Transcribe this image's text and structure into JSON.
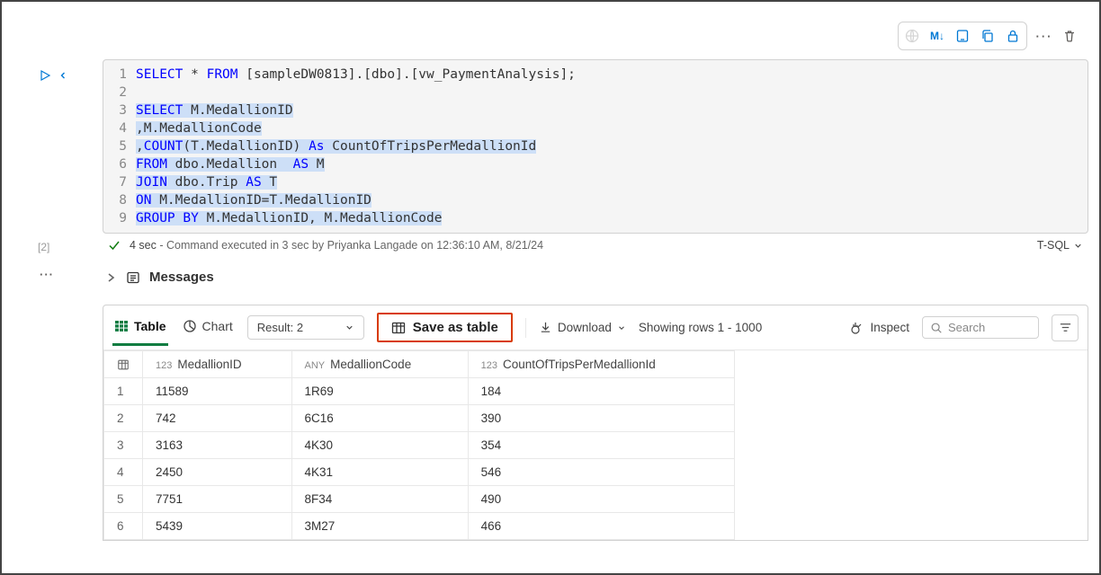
{
  "toolbar": {
    "icons": [
      "globe",
      "markdown",
      "tablet",
      "copy",
      "lock",
      "more",
      "trash"
    ],
    "md_label": "M↓"
  },
  "cell": {
    "exec_count": "[2]",
    "side_more": "···",
    "run_icon": "run",
    "lang": "T-SQL",
    "status_check": "✓",
    "status_bold": "4 sec",
    "status_text": "- Command executed in 3 sec by Priyanka Langade on 12:36:10 AM, 8/21/24"
  },
  "code": {
    "lines": [
      {
        "n": "1",
        "seg": [
          [
            "SELECT",
            "kw"
          ],
          [
            " ",
            ""
          ],
          [
            "*",
            ""
          ],
          [
            " ",
            ""
          ],
          [
            "FROM",
            "kw"
          ],
          [
            " ",
            ""
          ],
          [
            "[sampleDW0813].[dbo].[vw_PaymentAnalysis];",
            ""
          ]
        ]
      },
      {
        "n": "2",
        "seg": [
          [
            "",
            ""
          ]
        ]
      },
      {
        "n": "3",
        "sel": true,
        "seg": [
          [
            "SELECT",
            "kw"
          ],
          [
            " M.MedallionID",
            ""
          ]
        ]
      },
      {
        "n": "4",
        "sel": true,
        "seg": [
          [
            ",M.MedallionCode",
            ""
          ]
        ]
      },
      {
        "n": "5",
        "sel": true,
        "seg": [
          [
            ",",
            ""
          ],
          [
            "COUNT",
            "fn"
          ],
          [
            "(T.MedallionID) ",
            ""
          ],
          [
            "As",
            "kw"
          ],
          [
            " CountOfTripsPerMedallionId",
            ""
          ]
        ]
      },
      {
        "n": "6",
        "sel": true,
        "seg": [
          [
            "FROM",
            "kw"
          ],
          [
            " dbo.Medallion  ",
            ""
          ],
          [
            "AS",
            "kw"
          ],
          [
            " M",
            ""
          ]
        ]
      },
      {
        "n": "7",
        "sel": true,
        "seg": [
          [
            "JOIN",
            "kw"
          ],
          [
            " dbo.Trip ",
            ""
          ],
          [
            "AS",
            "kw"
          ],
          [
            " T",
            ""
          ]
        ]
      },
      {
        "n": "8",
        "sel": true,
        "seg": [
          [
            "ON",
            "kw"
          ],
          [
            " M.MedallionID=T.MedallionID",
            ""
          ]
        ]
      },
      {
        "n": "9",
        "sel": true,
        "seg": [
          [
            "GROUP BY",
            "kw"
          ],
          [
            " M.MedallionID, M.MedallionCode",
            ""
          ]
        ]
      }
    ]
  },
  "messages": {
    "label": "Messages"
  },
  "results": {
    "tabs": {
      "table": "Table",
      "chart": "Chart"
    },
    "result_select": "Result: 2",
    "save_label": "Save as table",
    "download": "Download",
    "rows_info": "Showing rows 1 - 1000",
    "inspect": "Inspect",
    "search_placeholder": "Search",
    "columns": [
      {
        "prefix": "123",
        "name": "MedallionID"
      },
      {
        "prefix": "ANY",
        "name": "MedallionCode"
      },
      {
        "prefix": "123",
        "name": "CountOfTripsPerMedallionId"
      }
    ],
    "rows": [
      {
        "n": "1",
        "c": [
          "11589",
          "1R69",
          "184"
        ]
      },
      {
        "n": "2",
        "c": [
          "742",
          "6C16",
          "390"
        ]
      },
      {
        "n": "3",
        "c": [
          "3163",
          "4K30",
          "354"
        ]
      },
      {
        "n": "4",
        "c": [
          "2450",
          "4K31",
          "546"
        ]
      },
      {
        "n": "5",
        "c": [
          "7751",
          "8F34",
          "490"
        ]
      },
      {
        "n": "6",
        "c": [
          "5439",
          "3M27",
          "466"
        ]
      }
    ]
  }
}
